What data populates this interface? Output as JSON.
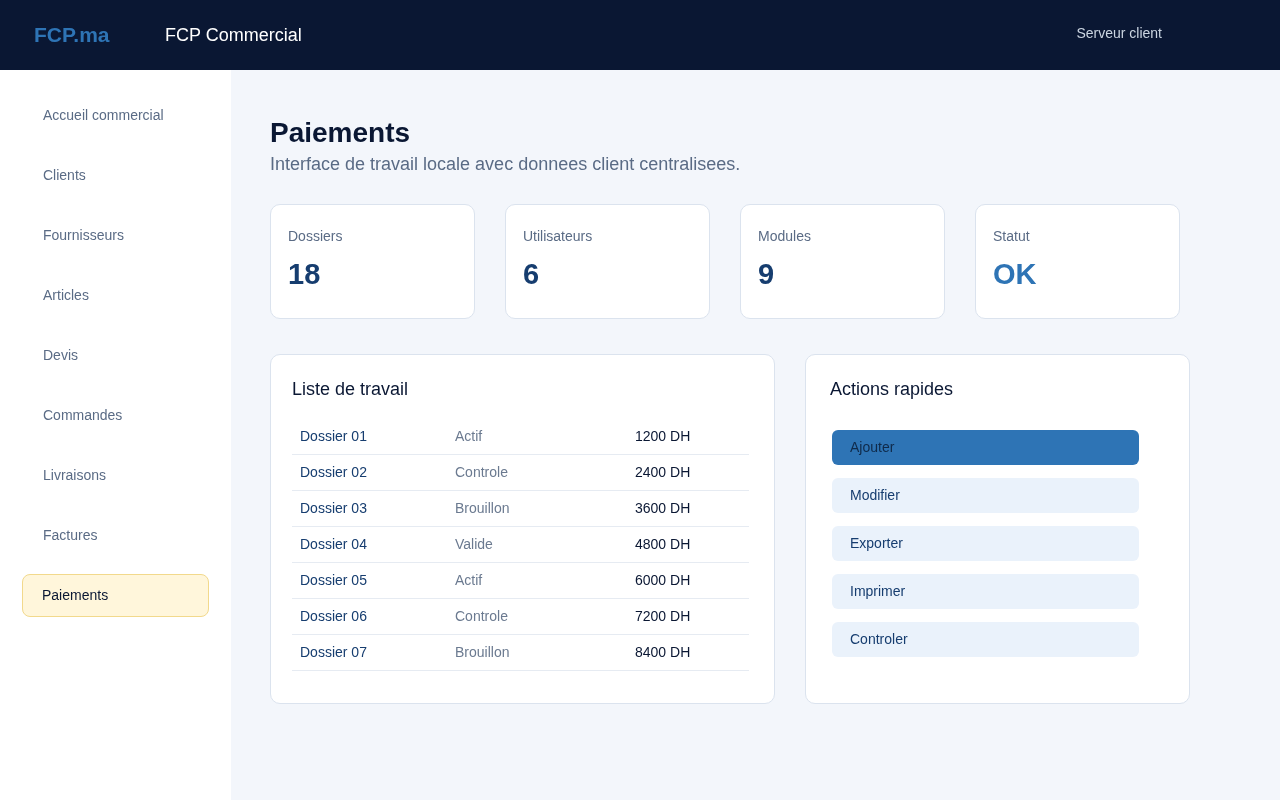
{
  "header": {
    "logo": "FCP.ma",
    "title": "FCP Commercial",
    "server": "Serveur client"
  },
  "sidebar": {
    "items": [
      {
        "label": "Accueil commercial",
        "selected": false
      },
      {
        "label": "Clients",
        "selected": false
      },
      {
        "label": "Fournisseurs",
        "selected": false
      },
      {
        "label": "Articles",
        "selected": false
      },
      {
        "label": "Devis",
        "selected": false
      },
      {
        "label": "Commandes",
        "selected": false
      },
      {
        "label": "Livraisons",
        "selected": false
      },
      {
        "label": "Factures",
        "selected": false
      },
      {
        "label": "Paiements",
        "selected": true
      }
    ]
  },
  "page": {
    "title": "Paiements",
    "subtitle": "Interface de travail locale avec donnees client centralisees."
  },
  "stats": [
    {
      "label": "Dossiers",
      "value": "18",
      "kind": "count"
    },
    {
      "label": "Utilisateurs",
      "value": "6",
      "kind": "count"
    },
    {
      "label": "Modules",
      "value": "9",
      "kind": "count"
    },
    {
      "label": "Statut",
      "value": "OK",
      "kind": "status"
    }
  ],
  "work_list": {
    "title": "Liste de travail",
    "rows": [
      {
        "name": "Dossier 01",
        "status": "Actif",
        "amount": "1200 DH"
      },
      {
        "name": "Dossier 02",
        "status": "Controle",
        "amount": "2400 DH"
      },
      {
        "name": "Dossier 03",
        "status": "Brouillon",
        "amount": "3600 DH"
      },
      {
        "name": "Dossier 04",
        "status": "Valide",
        "amount": "4800 DH"
      },
      {
        "name": "Dossier 05",
        "status": "Actif",
        "amount": "6000 DH"
      },
      {
        "name": "Dossier 06",
        "status": "Controle",
        "amount": "7200 DH"
      },
      {
        "name": "Dossier 07",
        "status": "Brouillon",
        "amount": "8400 DH"
      }
    ]
  },
  "quick_actions": {
    "title": "Actions rapides",
    "buttons": [
      {
        "label": "Ajouter",
        "kind": "primary"
      },
      {
        "label": "Modifier",
        "kind": "secondary"
      },
      {
        "label": "Exporter",
        "kind": "secondary"
      },
      {
        "label": "Imprimer",
        "kind": "secondary"
      },
      {
        "label": "Controler",
        "kind": "secondary"
      }
    ]
  }
}
